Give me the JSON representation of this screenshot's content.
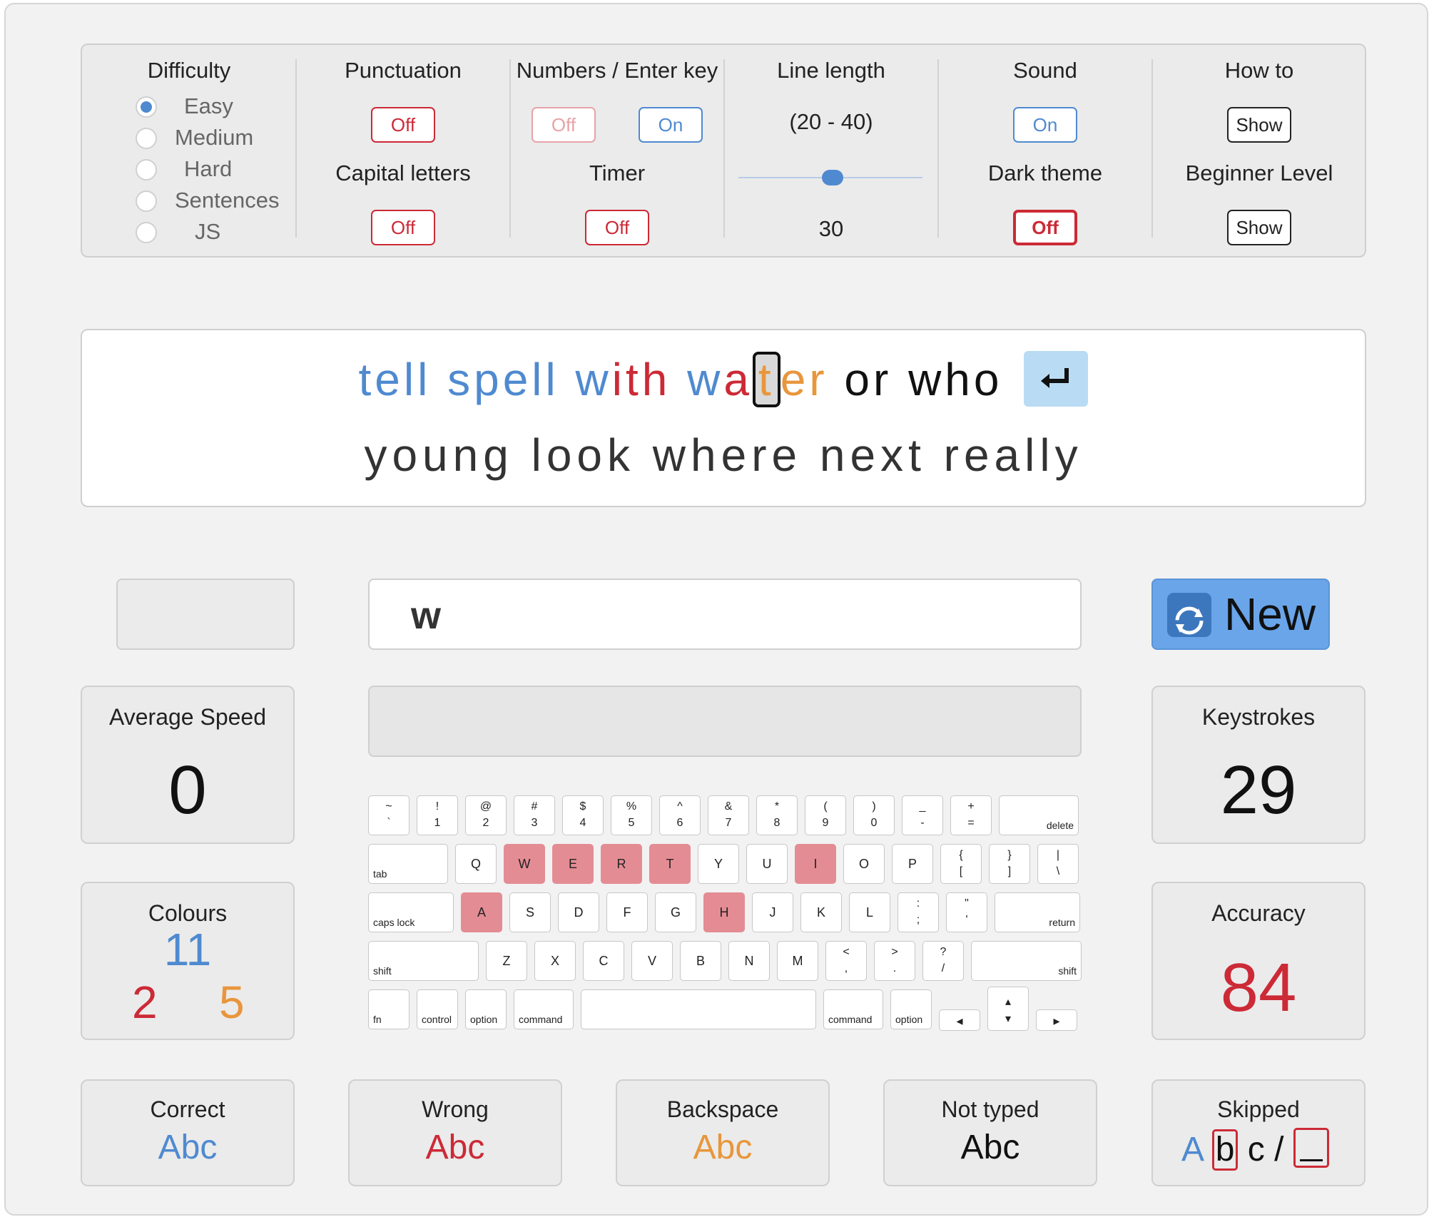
{
  "settings": {
    "difficulty": {
      "title": "Difficulty",
      "options": [
        "Easy",
        "Medium",
        "Hard",
        "Sentences",
        "JS"
      ],
      "selected": "Easy"
    },
    "punctuation": {
      "title": "Punctuation",
      "value": "Off"
    },
    "capital_letters": {
      "title": "Capital letters",
      "value": "Off"
    },
    "numbers_enter": {
      "title": "Numbers / Enter key",
      "numbers_value": "Off",
      "enter_value": "On"
    },
    "timer": {
      "title": "Timer",
      "value": "Off"
    },
    "line_length": {
      "title": "Line length",
      "range": "(20 - 40)",
      "value": "30",
      "level": 0.5
    },
    "sound": {
      "title": "Sound",
      "value": "On"
    },
    "dark_theme": {
      "title": "Dark theme",
      "value": "Off"
    },
    "how_to": {
      "title": "How to",
      "button": "Show"
    },
    "beginner_level": {
      "title": "Beginner Level",
      "button": "Show"
    }
  },
  "text": {
    "line1": [
      {
        "t": "tell spell w",
        "c": "blue"
      },
      {
        "t": "ith",
        "c": "red"
      },
      {
        "t": " w",
        "c": "blue"
      },
      {
        "t": "a",
        "c": "red"
      },
      {
        "t": "t",
        "c": "cursor"
      },
      {
        "t": "er",
        "c": "orange"
      },
      {
        "t": " or who",
        "c": "black"
      }
    ],
    "line2": "young look where next really",
    "enter_icon": "enter-arrow-icon"
  },
  "input": {
    "value": "w"
  },
  "new_button": {
    "label": "New",
    "icon": "refresh-icon"
  },
  "stats": {
    "average_speed": {
      "title": "Average Speed",
      "value": "0"
    },
    "colours": {
      "title": "Colours",
      "blue": "11",
      "red": "2",
      "orange": "5"
    },
    "keystrokes": {
      "title": "Keystrokes",
      "value": "29"
    },
    "accuracy": {
      "title": "Accuracy",
      "value": "84"
    }
  },
  "legend": {
    "correct": {
      "title": "Correct",
      "sample": "Abc"
    },
    "wrong": {
      "title": "Wrong",
      "sample": "Abc"
    },
    "backspace": {
      "title": "Backspace",
      "sample": "Abc"
    },
    "not_typed": {
      "title": "Not typed",
      "sample": "Abc"
    },
    "skipped": {
      "title": "Skipped",
      "a": "A",
      "b": "b",
      "c": "c",
      "slash": "/"
    }
  },
  "colors": {
    "blue": "#4f8ad0",
    "red": "#cc2a36",
    "orange": "#e8963c",
    "highlight": "#e48c94"
  },
  "keyboard": {
    "row1": [
      {
        "top": "~",
        "bot": "`"
      },
      {
        "top": "!",
        "bot": "1"
      },
      {
        "top": "@",
        "bot": "2"
      },
      {
        "top": "#",
        "bot": "3"
      },
      {
        "top": "$",
        "bot": "4"
      },
      {
        "top": "%",
        "bot": "5"
      },
      {
        "top": "^",
        "bot": "6"
      },
      {
        "top": "&",
        "bot": "7"
      },
      {
        "top": "*",
        "bot": "8"
      },
      {
        "top": "(",
        "bot": "9"
      },
      {
        "top": ")",
        "bot": "0"
      },
      {
        "top": "_",
        "bot": "-"
      },
      {
        "top": "+",
        "bot": "="
      },
      {
        "label": "delete"
      }
    ],
    "row2": [
      {
        "label": "tab"
      },
      {
        "ch": "Q"
      },
      {
        "ch": "W",
        "hl": true
      },
      {
        "ch": "E",
        "hl": true
      },
      {
        "ch": "R",
        "hl": true
      },
      {
        "ch": "T",
        "hl": true
      },
      {
        "ch": "Y"
      },
      {
        "ch": "U"
      },
      {
        "ch": "I",
        "hl": true
      },
      {
        "ch": "O"
      },
      {
        "ch": "P"
      },
      {
        "top": "{",
        "bot": "["
      },
      {
        "top": "}",
        "bot": "]"
      },
      {
        "top": "|",
        "bot": "\\"
      }
    ],
    "row3": [
      {
        "label": "caps lock"
      },
      {
        "ch": "A",
        "hl": true
      },
      {
        "ch": "S"
      },
      {
        "ch": "D"
      },
      {
        "ch": "F"
      },
      {
        "ch": "G"
      },
      {
        "ch": "H",
        "hl": true
      },
      {
        "ch": "J"
      },
      {
        "ch": "K"
      },
      {
        "ch": "L"
      },
      {
        "top": ":",
        "bot": ";"
      },
      {
        "top": "\"",
        "bot": "'"
      },
      {
        "label": "return"
      }
    ],
    "row4": [
      {
        "label": "shift"
      },
      {
        "ch": "Z"
      },
      {
        "ch": "X"
      },
      {
        "ch": "C"
      },
      {
        "ch": "V"
      },
      {
        "ch": "B"
      },
      {
        "ch": "N"
      },
      {
        "ch": "M"
      },
      {
        "top": "<",
        "bot": ","
      },
      {
        "top": ">",
        "bot": "."
      },
      {
        "top": "?",
        "bot": "/"
      },
      {
        "label": "shift"
      }
    ],
    "row5": [
      {
        "label": "fn"
      },
      {
        "label": "control"
      },
      {
        "label": "option"
      },
      {
        "label": "command"
      },
      {
        "label": ""
      },
      {
        "label": "command"
      },
      {
        "label": "option"
      },
      {
        "ch": "◂"
      },
      {
        "top": "▴",
        "bot": "▾"
      },
      {
        "ch": "▸"
      }
    ]
  }
}
